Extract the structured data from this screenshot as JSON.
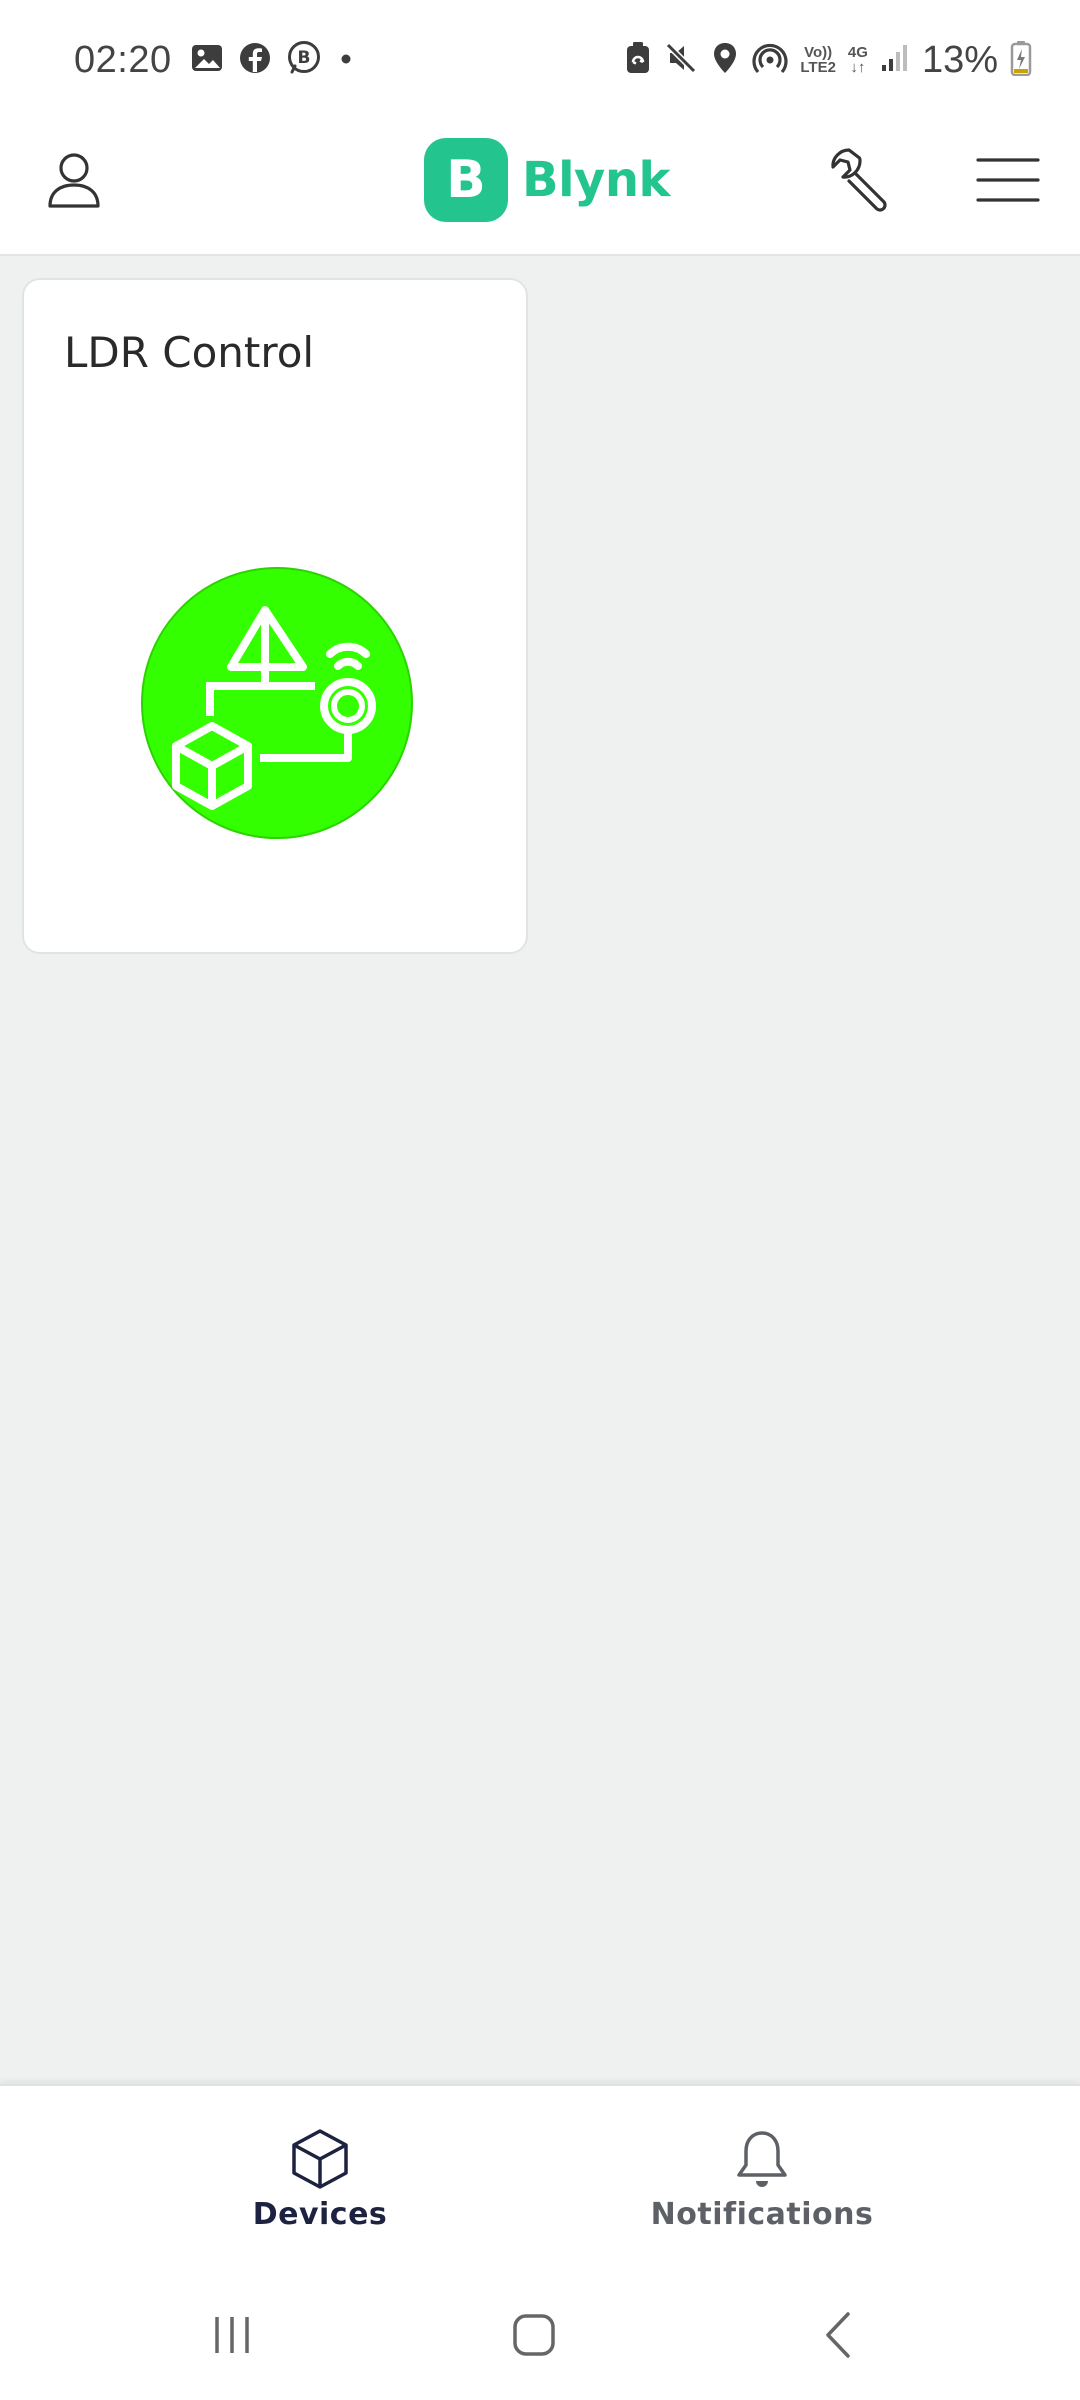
{
  "status_bar": {
    "time": "02:20",
    "battery_text": "13%",
    "network_volte": "Vo))",
    "network_lte": "LTE2",
    "network_type": "4G",
    "left_icons": [
      "gallery-icon",
      "facebook-icon",
      "b-circle-icon",
      "dot-icon"
    ],
    "right_icons": [
      "battery-saver-icon",
      "mute-icon",
      "location-icon",
      "hotspot-icon",
      "volte-icon",
      "data-4g-icon",
      "signal-icon",
      "battery-charging-icon"
    ]
  },
  "header": {
    "brand_letter": "B",
    "brand_name": "Blynk",
    "brand_color": "#23c48e",
    "icons": [
      "profile-icon",
      "wrench-icon",
      "menu-icon"
    ]
  },
  "devices": [
    {
      "name": "LDR Control",
      "icon": "device-template-icon",
      "icon_color": "#33ff00"
    }
  ],
  "bottom_nav": {
    "tabs": [
      {
        "label": "Devices",
        "icon": "cube-icon",
        "active": true
      },
      {
        "label": "Notifications",
        "icon": "bell-icon",
        "active": false
      }
    ]
  },
  "system_nav": {
    "buttons": [
      "recents-icon",
      "home-icon",
      "back-icon"
    ]
  }
}
